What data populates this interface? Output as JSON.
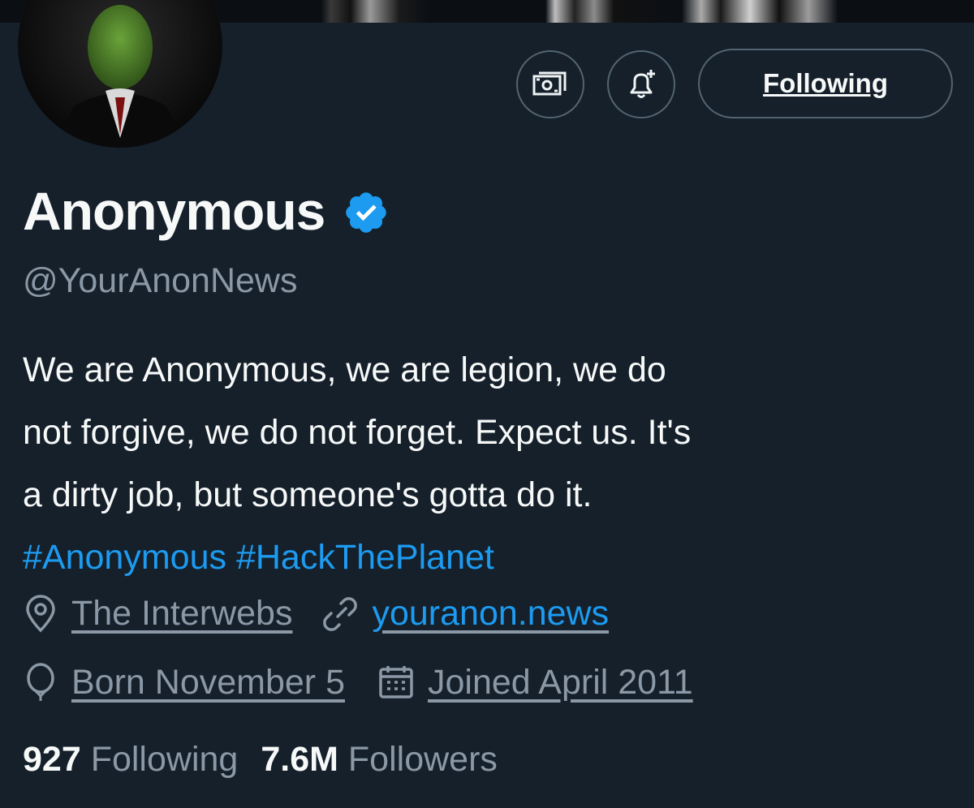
{
  "profile": {
    "display_name": "Anonymous",
    "handle": "@YourAnonNews",
    "verified": true,
    "bio_lines": [
      "We are Anonymous, we are legion, we do",
      "not forgive, we do not forget. Expect us. It's",
      "a dirty job, but someone's gotta do it."
    ],
    "hashtags": [
      "#Anonymous",
      "#HackThePlanet"
    ],
    "location": "The Interwebs",
    "website": "youranon.news",
    "birthday": "Born November 5",
    "joined": "Joined April 2011"
  },
  "actions": {
    "following_label": "Following",
    "tip_icon": "money-icon",
    "notify_icon": "bell-plus-icon"
  },
  "stats": {
    "following_count": "927",
    "following_label": "Following",
    "followers_count": "7.6M",
    "followers_label": "Followers"
  },
  "colors": {
    "background": "#15202b",
    "primary_text": "#f7f9f9",
    "secondary_text": "#8b98a5",
    "accent": "#1d9bf0",
    "border": "#536471"
  }
}
